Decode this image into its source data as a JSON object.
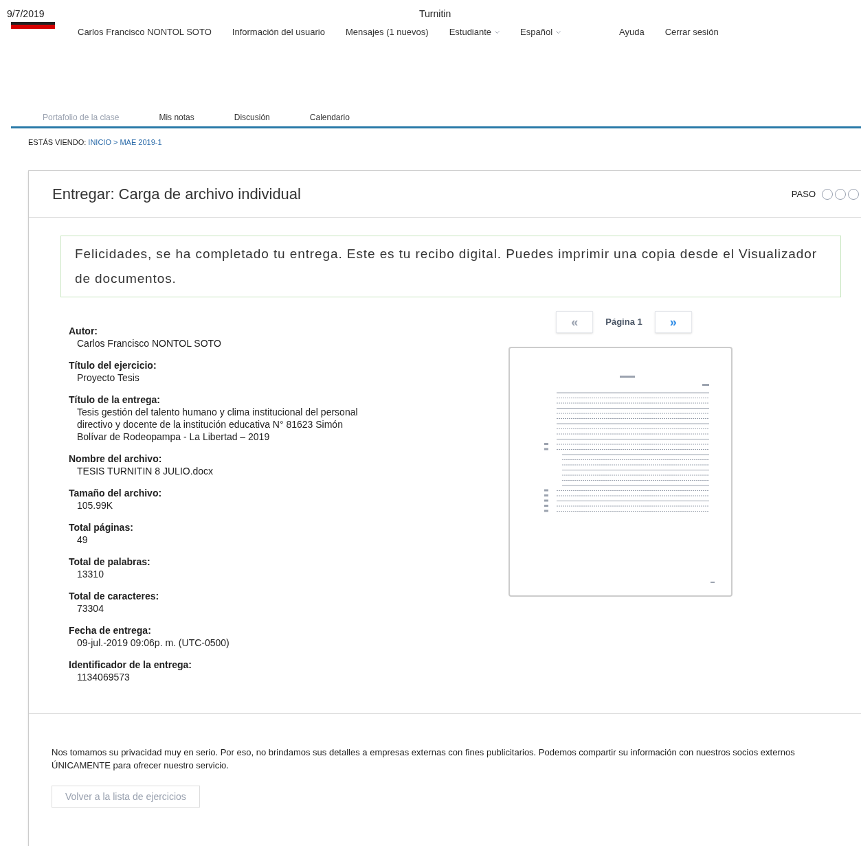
{
  "header": {
    "date": "9/7/2019",
    "title": "Turnitin"
  },
  "user_nav": [
    {
      "label": "Carlos Francisco NONTOL SOTO",
      "dropdown": false
    },
    {
      "label": "Información del usuario",
      "dropdown": false
    },
    {
      "label": "Mensajes (1 nuevos)",
      "dropdown": false
    },
    {
      "label": "Estudiante",
      "dropdown": true
    },
    {
      "label": "Español",
      "dropdown": true
    },
    {
      "label": "Ayuda",
      "dropdown": false
    },
    {
      "label": "Cerrar sesión",
      "dropdown": false
    }
  ],
  "tabs": [
    {
      "label": "Portafolio de la clase",
      "selected": true
    },
    {
      "label": "Mis notas",
      "selected": false
    },
    {
      "label": "Discusión",
      "selected": false
    },
    {
      "label": "Calendario",
      "selected": false
    }
  ],
  "breadcrumb": {
    "prefix": "ESTÁS VIENDO:",
    "links": [
      "INICIO",
      "MAE 2019-1"
    ],
    "separator": ">"
  },
  "panel": {
    "title": "Entregar: Carga de archivo individual",
    "step_label": "PASO",
    "steps": [
      {
        "filled": false
      },
      {
        "filled": false
      },
      {
        "filled": false
      }
    ],
    "success_message": "Felicidades, se ha completado tu entrega. Este es tu recibo digital. Puedes imprimir una copia desde el Visualizador de documentos.",
    "details": [
      {
        "label": "Autor:",
        "value": "Carlos Francisco NONTOL SOTO"
      },
      {
        "label": "Título del ejercicio:",
        "value": "Proyecto Tesis"
      },
      {
        "label": "Título de la entrega:",
        "value": "Tesis gestión del talento humano y clima institucional del personal directivo y docente de la institución educativa N° 81623 Simón Bolívar de Rodeopampa - La Libertad – 2019"
      },
      {
        "label": "Nombre del archivo:",
        "value": "TESIS TURNITIN 8 JULIO.docx"
      },
      {
        "label": "Tamaño del archivo:",
        "value": "105.99K"
      },
      {
        "label": "Total páginas:",
        "value": "49"
      },
      {
        "label": "Total de palabras:",
        "value": "13310"
      },
      {
        "label": "Total de caracteres:",
        "value": "73304"
      },
      {
        "label": "Fecha de entrega:",
        "value": "09-jul.-2019 09:06p. m. (UTC-0500)"
      },
      {
        "label": "Identificador de la entrega:",
        "value": "1134069573"
      }
    ],
    "viewer": {
      "prev": {
        "label": "«",
        "disabled": true
      },
      "page_label": "Página 1",
      "next": {
        "label": "»",
        "disabled": false
      }
    },
    "privacy_notice": "Nos tomamos su privacidad muy en serio. Por eso, no brindamos sus detalles a empresas externas con fines publicitarios. Podemos compartir su información con nuestros socios externos ÚNICAMENTE para ofrecer nuestro servicio.",
    "back_button": {
      "label": "Volver a la lista de ejercicios",
      "disabled": true
    }
  }
}
